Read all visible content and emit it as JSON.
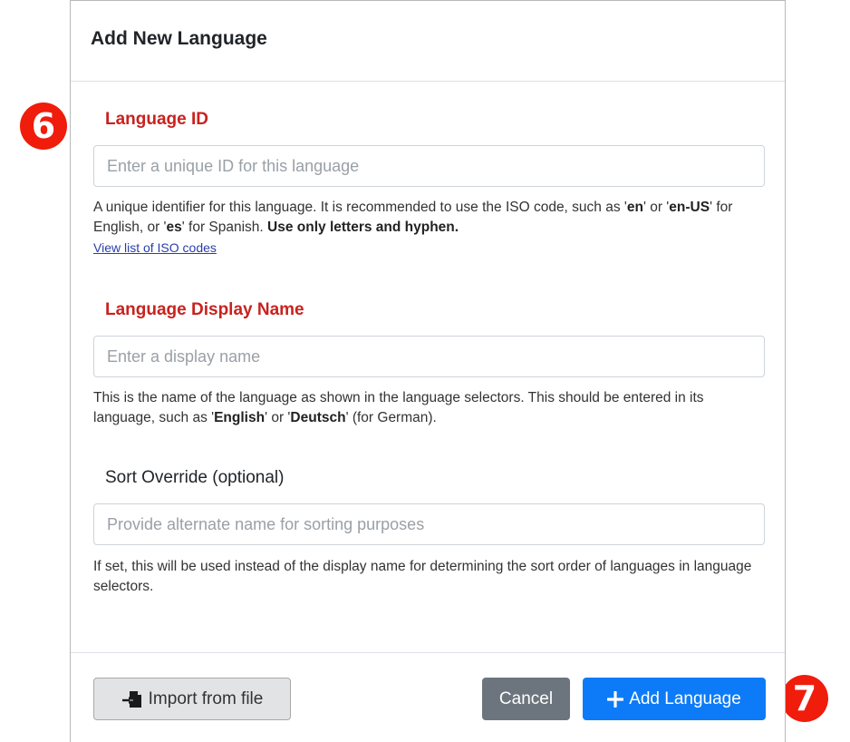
{
  "modal": {
    "title": "Add New Language"
  },
  "language_id": {
    "label": "Language ID",
    "placeholder": "Enter a unique ID for this language",
    "help_intro": "A unique identifier for this language. It is recommended to use the ISO code, such as '",
    "help_code_en": "en",
    "help_or": "' or '",
    "help_code_en_us": "en-US",
    "help_for_english": "' for English, or '",
    "help_code_es": "es",
    "help_for_spanish": "' for Spanish. ",
    "help_rule": "Use only letters and hyphen.",
    "link_text": "View list of ISO codes"
  },
  "display_name": {
    "label": "Language Display Name",
    "placeholder": "Enter a display name",
    "help_intro": "This is the name of the language as shown in the language selectors. This should be entered in its language, such as '",
    "help_example_1": "English",
    "help_or": "' or '",
    "help_example_2": "Deutsch",
    "help_end": "' (for German)."
  },
  "sort_override": {
    "label": "Sort Override (optional)",
    "placeholder": "Provide alternate name for sorting purposes",
    "help": "If set, this will be used instead of the display name for determining the sort order of languages in language selectors."
  },
  "footer": {
    "import_label": "Import from file",
    "cancel_label": "Cancel",
    "add_label": "Add Language"
  },
  "callouts": {
    "six": "6",
    "seven": "7"
  },
  "icons": {
    "import": "file-import-icon",
    "add": "plus-icon"
  },
  "colors": {
    "required_label": "#c8221f",
    "primary": "#0d7bf7",
    "secondary": "#6c757d",
    "callout": "#f01c0c"
  }
}
